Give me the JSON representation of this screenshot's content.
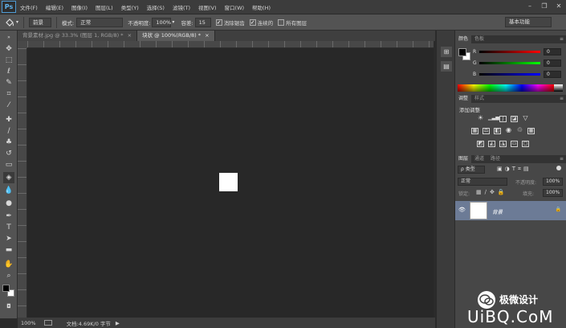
{
  "app": {
    "logo": "Ps"
  },
  "menubar": {
    "items": [
      "文件(F)",
      "编辑(E)",
      "图像(I)",
      "图层(L)",
      "类型(Y)",
      "选择(S)",
      "滤镜(T)",
      "视图(V)",
      "窗口(W)",
      "帮助(H)"
    ],
    "window_controls": {
      "minimize": "–",
      "restore": "❐",
      "close": "✕"
    }
  },
  "options": {
    "tool_preset": "▾",
    "source": "前景",
    "mode_label": "模式:",
    "mode_value": "正常",
    "opacity_label": "不透明度:",
    "opacity_value": "100%",
    "tolerance_label": "容差:",
    "tolerance_value": "15",
    "antialias_label": "消除锯齿",
    "antialias_checked": "✓",
    "contiguous_label": "连续的",
    "contiguous_checked": "✓",
    "all_layers_label": "所有图层",
    "all_layers_checked": "",
    "workspace": "基本功能"
  },
  "tabs": [
    {
      "label": "背景素材.jpg @ 33.3% (图层 1, RGB/8) *",
      "close": "×"
    },
    {
      "label": "块状 @ 100%(RGB/8) *",
      "close": "×"
    }
  ],
  "status": {
    "zoom": "100%",
    "doc_info": "文档:4.69K/0 字节",
    "arrow": "▶"
  },
  "color_panel": {
    "tabs": [
      "颜色",
      "色板"
    ],
    "rows": [
      {
        "label": "R",
        "value": "0",
        "color": "#ff0000"
      },
      {
        "label": "G",
        "value": "0",
        "color": "#00ff00"
      },
      {
        "label": "B",
        "value": "0",
        "color": "#0000ff"
      }
    ],
    "foreground": "#000000",
    "background": "#ffffff"
  },
  "adjustments_panel": {
    "tabs": [
      "调整",
      "样式"
    ],
    "title": "添加调整"
  },
  "layers_panel": {
    "tabs": [
      "图层",
      "通道",
      "路径"
    ],
    "filter_kind": "ρ 类型",
    "blend_mode": "正常",
    "opacity_label": "不透明度:",
    "opacity_value": "100%",
    "lock_label": "锁定:",
    "fill_label": "填充:",
    "fill_value": "100%",
    "layer_name": "背景",
    "layer_lock": "🔒",
    "eye": "👁"
  },
  "watermark": {
    "cn": "极微设计",
    "uibq": "UiBQ.CoM"
  },
  "colors": {
    "menubar": "#3c3c3c",
    "optionsbar": "#535353",
    "canvas_bg": "#282828",
    "layer_selected": "#6c7b96",
    "ps_blue": "#62b3ec"
  }
}
